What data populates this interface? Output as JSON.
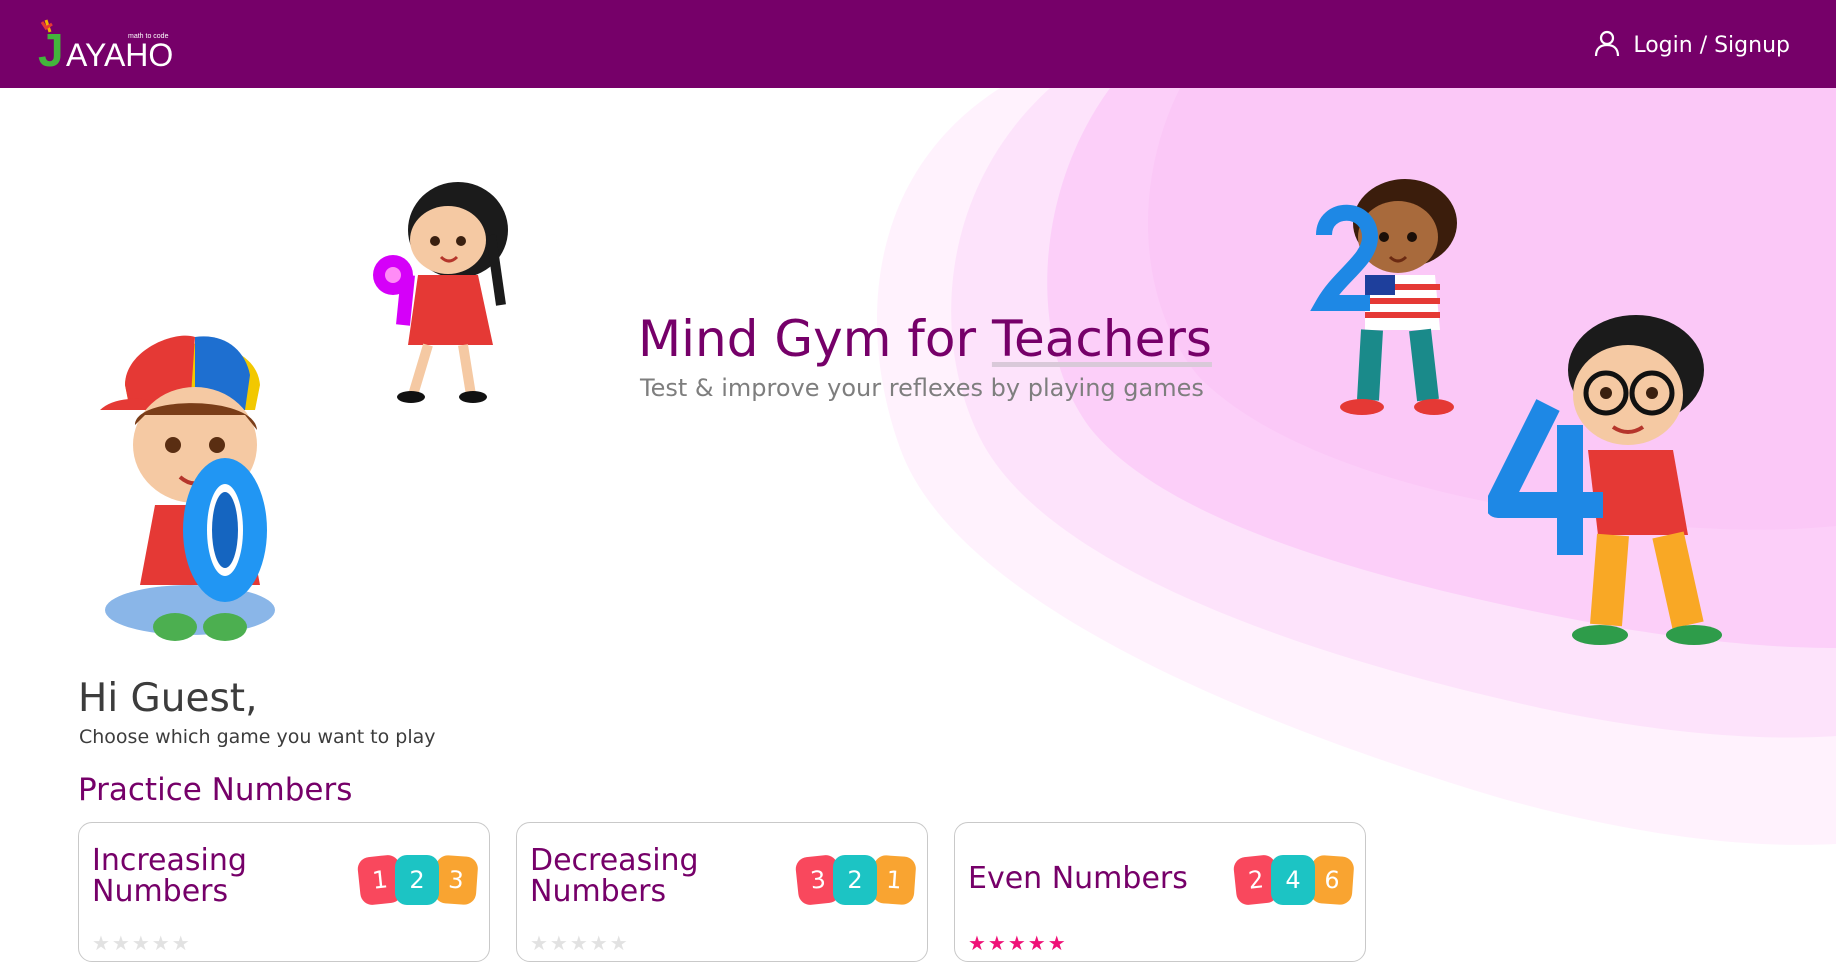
{
  "header": {
    "logo_text": "JAYAHO",
    "logo_tagline": "math to code",
    "login_label": "Login / Signup",
    "login_icon": "user-icon"
  },
  "hero": {
    "title_part1": "Mind Gym for ",
    "title_highlight": "Teachers",
    "subtitle": "Test & improve your reflexes by playing games"
  },
  "greeting": {
    "title": "Hi Guest,",
    "subtitle": "Choose which game you want to play"
  },
  "section": {
    "title": "Practice Numbers"
  },
  "cards": [
    {
      "title": "Increasing Numbers",
      "tiles": [
        "1",
        "2",
        "3"
      ],
      "stars_filled": 0,
      "stars_total": 5
    },
    {
      "title": "Decreasing Numbers",
      "tiles": [
        "3",
        "2",
        "1"
      ],
      "stars_filled": 0,
      "stars_total": 5
    },
    {
      "title": "Even Numbers",
      "tiles": [
        "2",
        "4",
        "6"
      ],
      "stars_filled": 5,
      "stars_total": 5
    }
  ],
  "colors": {
    "brand": "#760069",
    "tile_red": "#f9485d",
    "tile_teal": "#1cc4c4",
    "tile_orange": "#f9a431",
    "star": "#ef1177"
  }
}
